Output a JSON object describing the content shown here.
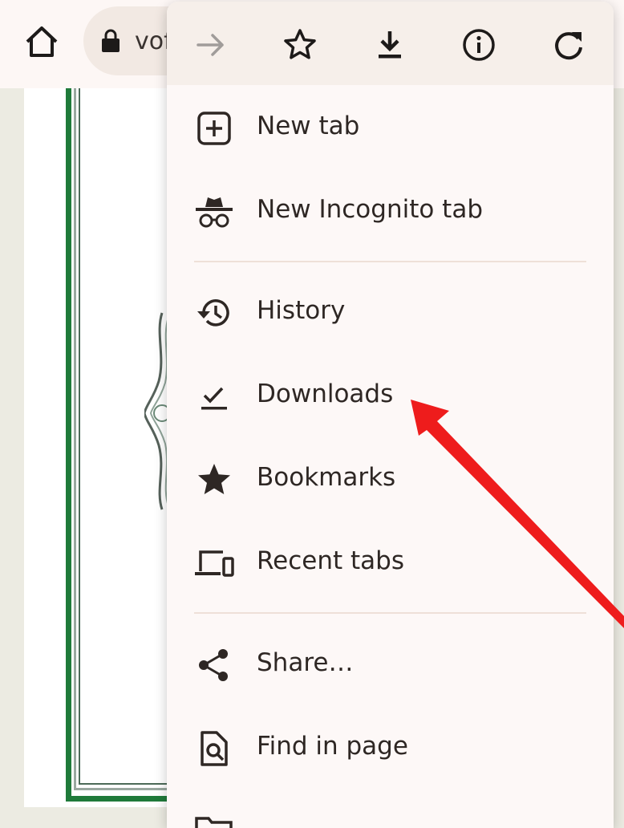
{
  "toolbar": {
    "url_text": "vof"
  },
  "menu": {
    "items": [
      {
        "label": "New tab",
        "icon": "new-tab-icon"
      },
      {
        "label": "New Incognito tab",
        "icon": "incognito-icon"
      },
      {
        "label": "History",
        "icon": "history-icon"
      },
      {
        "label": "Downloads",
        "icon": "downloads-icon"
      },
      {
        "label": "Bookmarks",
        "icon": "bookmark-star-icon"
      },
      {
        "label": "Recent tabs",
        "icon": "recent-tabs-icon"
      },
      {
        "label": "Share…",
        "icon": "share-icon"
      },
      {
        "label": "Find in page",
        "icon": "find-in-page-icon"
      }
    ]
  },
  "colors": {
    "menu_background": "#fdf8f7",
    "menu_top_background": "#f6efea",
    "icon_color": "#2e2724",
    "annotation_arrow": "#ee1c1c",
    "frame_green": "#1f7a3a"
  }
}
